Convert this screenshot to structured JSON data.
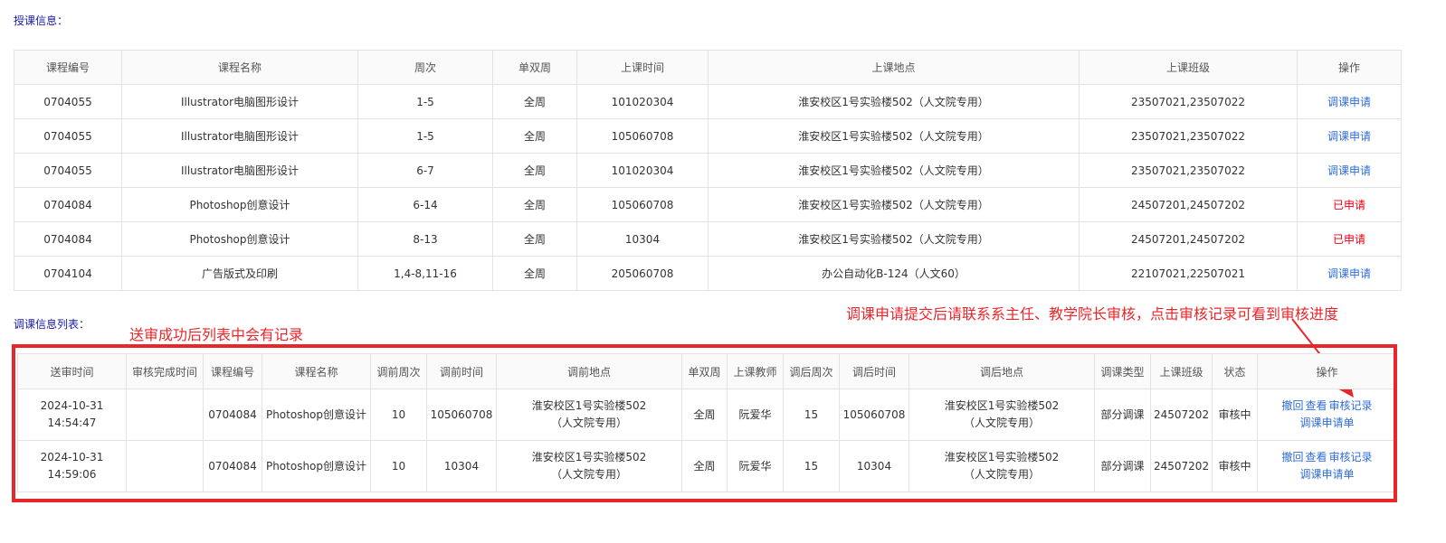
{
  "teaching": {
    "title": "授课信息：",
    "headers": [
      "课程编号",
      "课程名称",
      "周次",
      "单双周",
      "上课时间",
      "上课地点",
      "上课班级",
      "操作"
    ],
    "rows": [
      {
        "code": "0704055",
        "name": "Illustrator电脑图形设计",
        "weeks": "1-5",
        "parity": "全周",
        "time": "101020304",
        "place": "淮安校区1号实验楼502（人文院专用）",
        "classes": "23507021,23507022",
        "op": "调课申请",
        "op_state": "link"
      },
      {
        "code": "0704055",
        "name": "Illustrator电脑图形设计",
        "weeks": "1-5",
        "parity": "全周",
        "time": "105060708",
        "place": "淮安校区1号实验楼502（人文院专用）",
        "classes": "23507021,23507022",
        "op": "调课申请",
        "op_state": "link"
      },
      {
        "code": "0704055",
        "name": "Illustrator电脑图形设计",
        "weeks": "6-7",
        "parity": "全周",
        "time": "101020304",
        "place": "淮安校区1号实验楼502（人文院专用）",
        "classes": "23507021,23507022",
        "op": "调课申请",
        "op_state": "link"
      },
      {
        "code": "0704084",
        "name": "Photoshop创意设计",
        "weeks": "6-14",
        "parity": "全周",
        "time": "105060708",
        "place": "淮安校区1号实验楼502（人文院专用）",
        "classes": "24507201,24507202",
        "op": "已申请",
        "op_state": "applied"
      },
      {
        "code": "0704084",
        "name": "Photoshop创意设计",
        "weeks": "8-13",
        "parity": "全周",
        "time": "10304",
        "place": "淮安校区1号实验楼502（人文院专用）",
        "classes": "24507201,24507202",
        "op": "已申请",
        "op_state": "applied"
      },
      {
        "code": "0704104",
        "name": "广告版式及印刷",
        "weeks": "1,4-8,11-16",
        "parity": "全周",
        "time": "205060708",
        "place": "办公自动化B-124（人文60）",
        "classes": "22107021,22507021",
        "op": "调课申请",
        "op_state": "link"
      }
    ]
  },
  "adjust": {
    "title": "调课信息列表：",
    "headers": [
      "送审时间",
      "审核完成时间",
      "课程编号",
      "课程名称",
      "调前周次",
      "调前时间",
      "调前地点",
      "单双周",
      "上课教师",
      "调后周次",
      "调后时间",
      "调后地点",
      "调课类型",
      "上课班级",
      "状态",
      "操作"
    ],
    "rows": [
      {
        "submit_date": "2024-10-31",
        "submit_time": "14:54:47",
        "finish": "",
        "code": "0704084",
        "name": "Photoshop创意设计",
        "before_weeks": "10",
        "before_time": "105060708",
        "before_place1": "淮安校区1号实验楼502",
        "before_place2": "（人文院专用）",
        "parity": "全周",
        "teacher": "阮爱华",
        "after_weeks": "15",
        "after_time": "105060708",
        "after_place1": "淮安校区1号实验楼502",
        "after_place2": "（人文院专用）",
        "type": "部分调课",
        "classes": "24507202",
        "status": "审核中",
        "ops": [
          "撤回",
          "查看",
          "审核记录"
        ],
        "ops2": "调课申请单"
      },
      {
        "submit_date": "2024-10-31",
        "submit_time": "14:59:06",
        "finish": "",
        "code": "0704084",
        "name": "Photoshop创意设计",
        "before_weeks": "10",
        "before_time": "10304",
        "before_place1": "淮安校区1号实验楼502",
        "before_place2": "（人文院专用）",
        "parity": "全周",
        "teacher": "阮爱华",
        "after_weeks": "15",
        "after_time": "10304",
        "after_place1": "淮安校区1号实验楼502",
        "after_place2": "（人文院专用）",
        "type": "部分调课",
        "classes": "24507202",
        "status": "审核中",
        "ops": [
          "撤回",
          "查看",
          "审核记录"
        ],
        "ops2": "调课申请单"
      }
    ]
  },
  "annotations": {
    "left_note": "送审成功后列表中会有记录",
    "right_note": "调课申请提交后请联系系主任、教学院长审核，点击审核记录可看到审核进度",
    "color": "#e9262b"
  }
}
